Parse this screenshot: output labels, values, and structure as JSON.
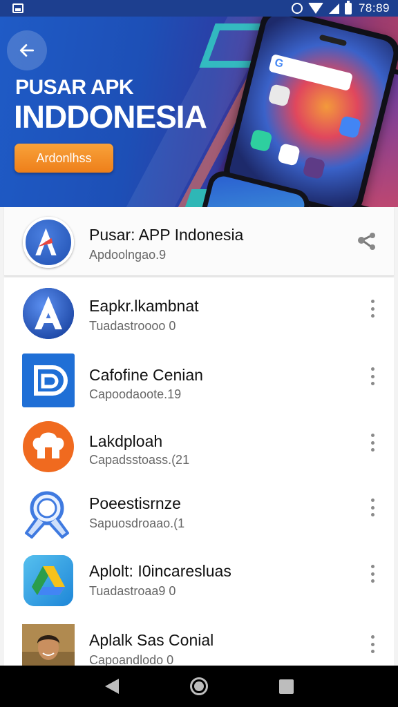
{
  "status_bar": {
    "time": "78:89"
  },
  "banner": {
    "line1": "PUSAR APK",
    "line2": "INDDONESIA",
    "button_label": "Ardonlhss"
  },
  "featured": {
    "title": "Pusar: APP Indonesia",
    "subtitle": "Apdoolngao.9"
  },
  "apps": [
    {
      "title": "Eapkr.lkambnat",
      "subtitle": "Tuadastroooo 0",
      "icon": "letter-a-icon"
    },
    {
      "title": "Cafofine Cenian",
      "subtitle": "Capoodaoote.19",
      "icon": "b-logo-icon"
    },
    {
      "title": "Lakdploah",
      "subtitle": "Capadsstoass.(21",
      "icon": "chef-hat-icon"
    },
    {
      "title": "Poeestisrnze",
      "subtitle": "Sapuosdroaao.(1",
      "icon": "magnifier-icon"
    },
    {
      "title": "Aplolt: I0incaresluas",
      "subtitle": "Tuadastroaa9 0",
      "icon": "drive-triangle-icon"
    },
    {
      "title": "Aplalk Sas Conial",
      "subtitle": "Capoandlodo 0",
      "icon": "person-photo-icon"
    }
  ],
  "colors": {
    "status_bar": "#1d3f8f",
    "banner_orange": "#f08a24",
    "icon_blue": "#1f4fb0",
    "nav_bar": "#000000"
  }
}
